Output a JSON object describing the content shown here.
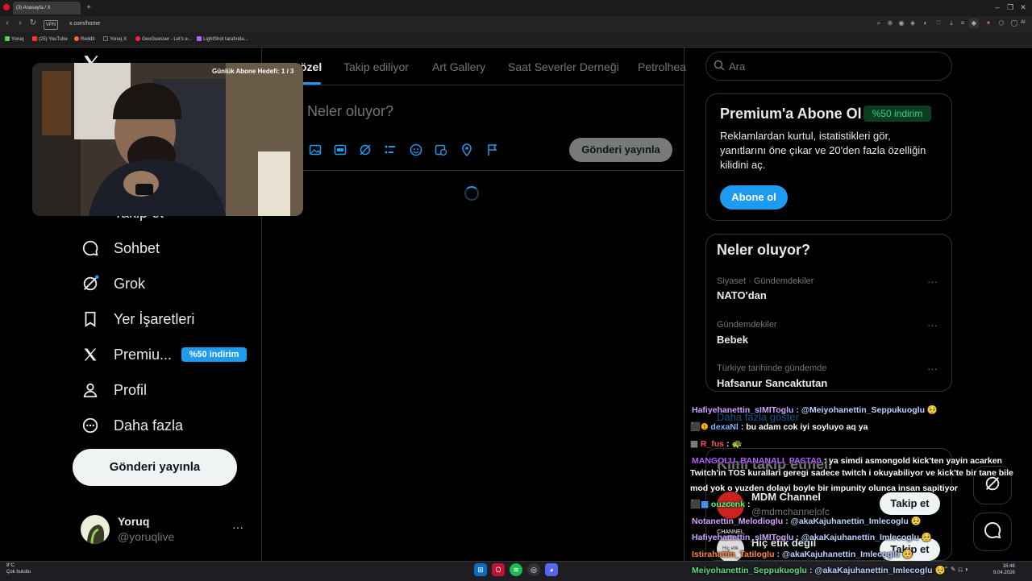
{
  "browser": {
    "tab_title": "(3) Anasayfa / X",
    "url": "x.com/home",
    "vpn_label": "VPN",
    "bookmarks": [
      "Yoruq",
      "(25) YouTube",
      "Reddit",
      "Yoruq X",
      "GeoGuesser - Let's e...",
      "LightShot tarafında..."
    ],
    "ext_label": "AI"
  },
  "tabs": [
    "özel",
    "Takip ediliyor",
    "Art Gallery",
    "Saat Severler Derneği",
    "Petrolhea"
  ],
  "nav": {
    "items": [
      {
        "label": "Takip et",
        "icon": "follow-icon"
      },
      {
        "label": "Sohbet",
        "icon": "chat-icon"
      },
      {
        "label": "Grok",
        "icon": "grok-icon"
      },
      {
        "label": "Yer İşaretleri",
        "icon": "bookmark-icon"
      },
      {
        "label": "Premiu...",
        "icon": "x-logo-icon"
      },
      {
        "label": "Profil",
        "icon": "profile-icon"
      },
      {
        "label": "Daha fazla",
        "icon": "more-circle-icon"
      }
    ],
    "premium_badge": "%50 indirim",
    "post_button": "Gönderi yayınla"
  },
  "account": {
    "name": "Yoruq",
    "handle": "@yoruqlive",
    "more": "···"
  },
  "compose": {
    "placeholder": "Neler oluyor?",
    "post_button": "Gönderi yayınla"
  },
  "search": {
    "placeholder": "Ara"
  },
  "premium": {
    "title": "Premium'a Abone Ol",
    "discount": "%50 indirim",
    "text": "Reklamlardan kurtul, istatistikleri gör, yanıtlarını öne çıkar ve 20'den fazla özelliğin kilidini aç.",
    "button": "Abone ol"
  },
  "trends": {
    "title": "Neler oluyor?",
    "items": [
      {
        "meta": "Siyaset · Gündemdekiler",
        "name": "NATO'dan"
      },
      {
        "meta": "Gündemdekiler",
        "name": "Bebek"
      },
      {
        "meta": "Türkiye tarihinde gündemde",
        "name": "Hafsanur Sancaktutan"
      }
    ],
    "show_more": "Daha fazla göster"
  },
  "who_to_follow": {
    "title": "Kimi takip etmeli",
    "items": [
      {
        "name": "MDM Channel",
        "handle": "@mdmchannelofc",
        "button": "Takip et",
        "avatar_text": "MDM CHANNEL"
      },
      {
        "name": "Hiç etik değil",
        "button": "Takip et",
        "avatar_text": "Hiç etik"
      }
    ]
  },
  "stream": {
    "sub_goal": "Günlük Abone Hedefi: 1 / 3"
  },
  "chat": [
    {
      "user": "Hafiyehanettin_sIMIToglu",
      "color": "#c9a7ff",
      "text": ": @Meiyohanettin_Seppukuoglu 🥺"
    },
    {
      "user": "dexaNl",
      "color": "#7ab8ff",
      "text": ": bu adam cok iyi soyluyo aq ya"
    },
    {
      "user": "R_fus",
      "color": "#ff4d6a",
      "text": ": 🐢"
    },
    {
      "user": "MANGOLU_BANANALI_PASTA0",
      "color": "#b45cff",
      "text": ": ya simdi asmongold kick'ten yayin acarken"
    },
    {
      "user": "",
      "color": "#ffffff",
      "text": "Twitch'in TOS kurallari geregi sadece twitch i okuyabiliyor ve kick'te bir tane bile"
    },
    {
      "user": "",
      "color": "#ffffff",
      "text": "mod yok o yuzden dolayi boyle bir impunity olunca insan sapitiyor"
    },
    {
      "user": "ouzcenk",
      "color": "#43ff7a",
      "text": ":"
    },
    {
      "user": "Notanettin_Melodioglu",
      "color": "#d8a2ff",
      "text": ": @akaKajuhanettin_Imlecoglu 🥺"
    },
    {
      "user": "Hafiyehanettin_sIMIToglu",
      "color": "#c9a7ff",
      "text": ": @akaKajuhanettin_Imlecoglu 🥺"
    },
    {
      "user": "Istirahattin_Tatiloglu",
      "color": "#ff8a3d",
      "text": ": @akaKajuhanettin_Imlecoglu 🥺"
    },
    {
      "user": "Meiyohanettin_Seppukuoglu",
      "color": "#58e07a",
      "text": ": @akaKajuhanettin_Imlecoglu 🥺"
    }
  ],
  "taskbar": {
    "weather_temp": "8°C",
    "weather_text": "Çok bulutlu",
    "time": "18:46",
    "date": "9.04.2026"
  }
}
